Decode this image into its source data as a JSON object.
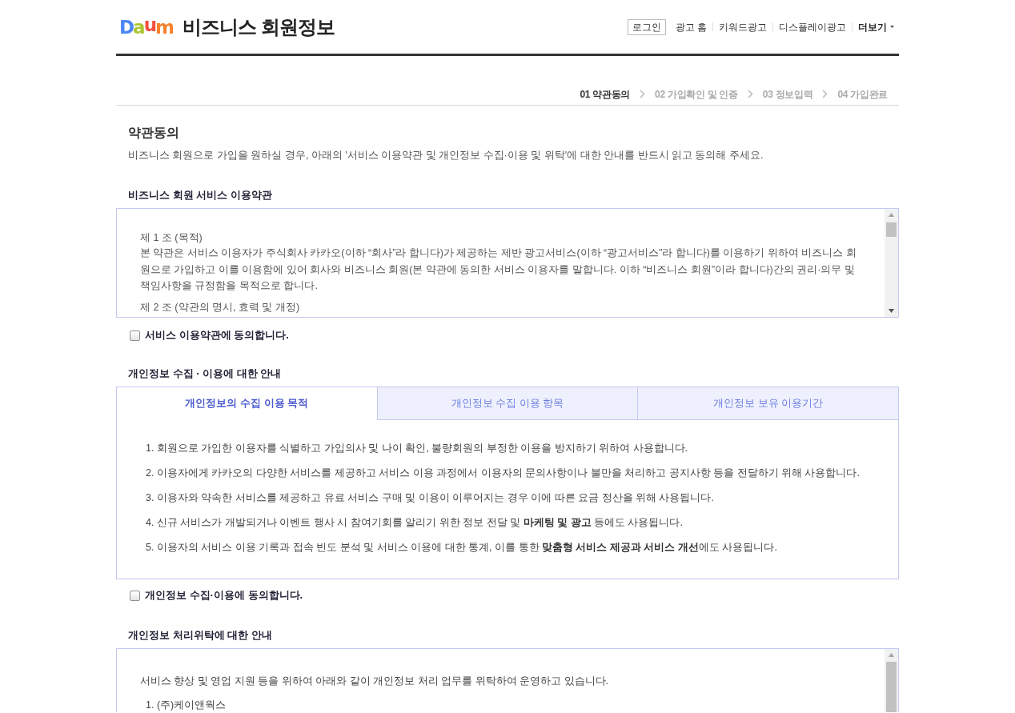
{
  "header": {
    "logo": "Daum",
    "title": "비즈니스 회원정보",
    "nav": [
      {
        "label": "로그인",
        "kind": "button"
      },
      {
        "label": "광고 홈",
        "kind": "link"
      },
      {
        "label": "키워드광고",
        "kind": "link"
      },
      {
        "label": "디스플레이광고",
        "kind": "link"
      },
      {
        "label": "더보기",
        "kind": "menu"
      }
    ]
  },
  "steps": [
    {
      "label": "01 약관동의",
      "selected": true
    },
    {
      "label": "02 가입확인 및 인증",
      "selected": false
    },
    {
      "label": "03 정보입력",
      "selected": false
    },
    {
      "label": "04 가입완료",
      "selected": false
    }
  ],
  "intro": {
    "title": "약관동의",
    "description": "비즈니스 회원으로 가입을 원하실 경우, 아래의 '서비스 이용약관 및 개인정보 수집·이용 및 위탁'에 대한 안내를 반드시 읽고 동의해 주세요."
  },
  "terms": {
    "heading": "비즈니스 회원 서비스 이용약관",
    "articles": [
      {
        "title": "제 1 조 (목적)",
        "body": "본 약관은 서비스 이용자가 주식회사 카카오(이하 “회사”라 합니다)가 제공하는 제반 광고서비스(이하 “광고서비스”라 합니다)를 이용하기 위하여 비즈니스 회원으로 가입하고 이를 이용함에 있어 회사와 비즈니스 회원(본 약관에 동의한 서비스 이용자를 말합니다. 이하 “비즈니스 회원”이라 합니다)간의 권리·의무 및 책임사항을 규정함을 목적으로 합니다."
      },
      {
        "title": "제 2 조 (약관의 명시, 효력 및 개정)"
      }
    ],
    "agree": {
      "label": "서비스 이용약관에 동의합니다.",
      "checked": false
    }
  },
  "privacy": {
    "heading": "개인정보 수집 · 이용에 대한 안내",
    "tabs": [
      {
        "label": "개인정보의 수집 이용 목적",
        "selected": true
      },
      {
        "label": "개인정보 수집 이용 항목",
        "selected": false
      },
      {
        "label": "개인정보 보유 이용기간",
        "selected": false
      }
    ],
    "items": [
      "1. 회원으로 가입한 이용자를 식별하고 가입의사 및 나이 확인, 불량회원의 부정한 이용을 방지하기 위하여 사용합니다.",
      "2. 이용자에게 카카오의 다양한 서비스를 제공하고 서비스 이용 과정에서 이용자의 문의사항이나 불만을 처리하고 공지사항 등을 전달하기 위해 사용합니다.",
      "3. 이용자와 약속한 서비스를 제공하고 유료 서비스 구매 및 이용이 이루어지는 경우 이에 따른 요금 정산을 위해 사용됩니다.",
      "4. 신규 서비스가 개발되거나 이벤트 행사 시 참여기회를 알리기 위한 정보 전달 및 **마케팅 및 광고** 등에도 사용됩니다.",
      "5. 이용자의 서비스 이용 기록과 접속 빈도 분석 및 서비스 이용에 대한 통계, 이를 통한 **맞춤형 서비스 제공과 서비스 개선**에도 사용됩니다."
    ],
    "agree": {
      "label": "개인정보 수집·이용에 동의합니다.",
      "checked": false
    }
  },
  "outsourcing": {
    "heading": "개인정보 처리위탁에 대한 안내",
    "intro": "서비스 향상 및 영업 지원 등을 위하여 아래와 같이 개인정보 처리 업무를 위탁하여 운영하고 있습니다.",
    "items": [
      "1. (주)케이앤웍스"
    ]
  }
}
